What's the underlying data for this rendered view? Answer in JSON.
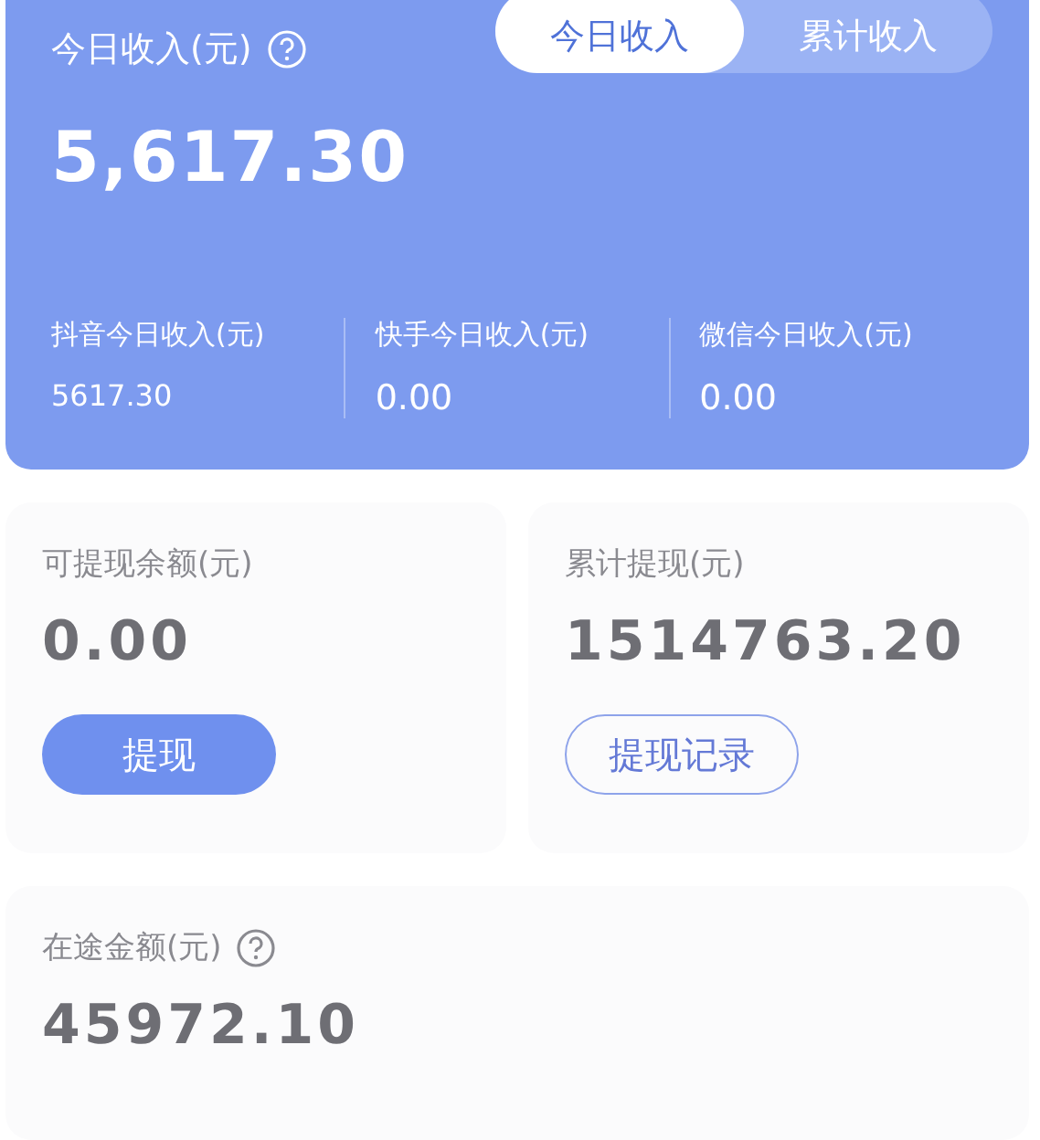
{
  "header": {
    "title": "今日收入(元)",
    "amount": "5,617.30",
    "tabs": [
      {
        "label": "今日收入",
        "selected": true
      },
      {
        "label": "累计收入",
        "selected": false
      }
    ],
    "platforms": [
      {
        "label": "抖音今日收入(元)",
        "value": "5617.30"
      },
      {
        "label": "快手今日收入(元)",
        "value": "0.00"
      },
      {
        "label": "微信今日收入(元)",
        "value": "0.00"
      }
    ]
  },
  "balance": {
    "label": "可提现余额(元)",
    "value": "0.00",
    "button": "提现"
  },
  "withdrawn": {
    "label": "累计提现(元)",
    "value": "1514763.20",
    "button": "提现记录"
  },
  "pending": {
    "label": "在途金额(元)",
    "value": "45972.10"
  }
}
